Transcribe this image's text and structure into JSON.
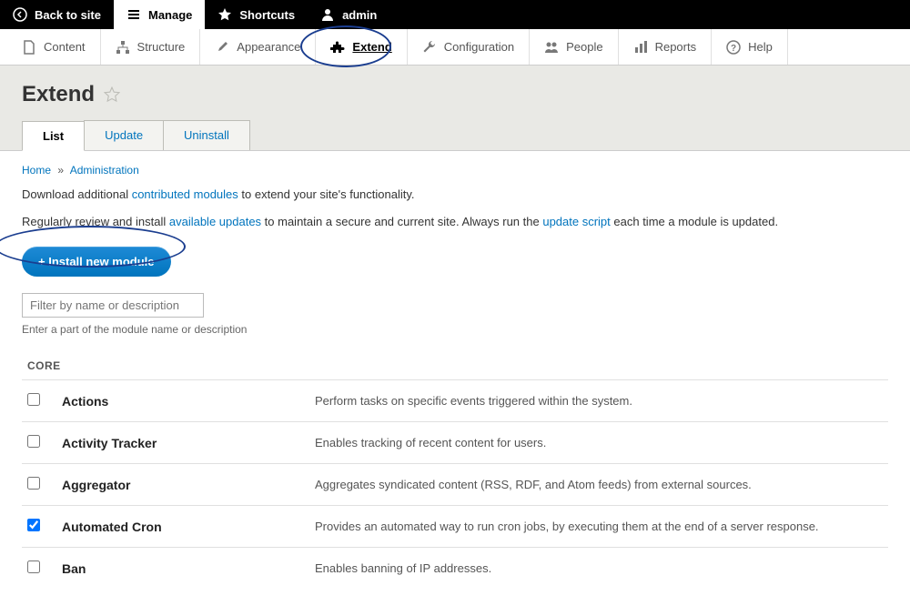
{
  "topbar": {
    "back": "Back to site",
    "manage": "Manage",
    "shortcuts": "Shortcuts",
    "user": "admin"
  },
  "adminmenu": [
    {
      "id": "content",
      "label": "Content"
    },
    {
      "id": "structure",
      "label": "Structure"
    },
    {
      "id": "appearance",
      "label": "Appearance"
    },
    {
      "id": "extend",
      "label": "Extend",
      "active": true
    },
    {
      "id": "configuration",
      "label": "Configuration"
    },
    {
      "id": "people",
      "label": "People"
    },
    {
      "id": "reports",
      "label": "Reports"
    },
    {
      "id": "help",
      "label": "Help"
    }
  ],
  "page": {
    "title": "Extend",
    "tabs": [
      {
        "label": "List",
        "active": true
      },
      {
        "label": "Update"
      },
      {
        "label": "Uninstall"
      }
    ],
    "breadcrumb": {
      "home": "Home",
      "admin": "Administration"
    },
    "desc_line1_pre": "Download additional ",
    "desc_line1_link": "contributed modules",
    "desc_line1_post": " to extend your site's functionality.",
    "desc_line2_pre": "Regularly review and install ",
    "desc_line2_link1": "available updates",
    "desc_line2_mid": " to maintain a secure and current site. Always run the ",
    "desc_line2_link2": "update script",
    "desc_line2_post": " each time a module is updated.",
    "install_button": "+ Install new module",
    "filter_placeholder": "Filter by name or description",
    "filter_help": "Enter a part of the module name or description",
    "section_header": "CORE",
    "modules": [
      {
        "name": "Actions",
        "desc": "Perform tasks on specific events triggered within the system.",
        "checked": false
      },
      {
        "name": "Activity Tracker",
        "desc": "Enables tracking of recent content for users.",
        "checked": false
      },
      {
        "name": "Aggregator",
        "desc": "Aggregates syndicated content (RSS, RDF, and Atom feeds) from external sources.",
        "checked": false
      },
      {
        "name": "Automated Cron",
        "desc": "Provides an automated way to run cron jobs, by executing them at the end of a server response.",
        "checked": true
      },
      {
        "name": "Ban",
        "desc": "Enables banning of IP addresses.",
        "checked": false
      }
    ]
  }
}
